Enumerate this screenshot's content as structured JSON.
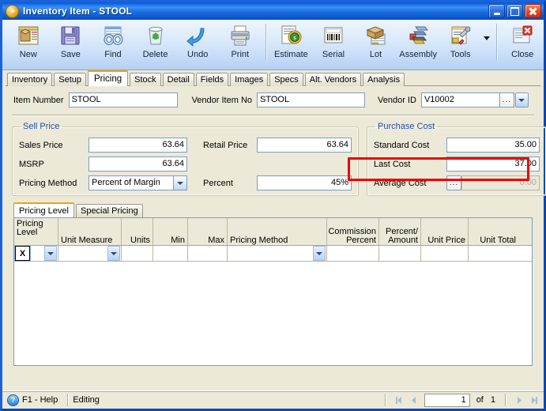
{
  "window": {
    "title_main": "Inventory Item",
    "title_sep": " - ",
    "title_item": "STOOL",
    "icon": "orange-play-icon",
    "controls": {
      "minimize": "Minimize",
      "maximize": "Maximize",
      "close": "Close"
    }
  },
  "toolbar": {
    "items": [
      {
        "label": "New",
        "icon": "new-item-icon"
      },
      {
        "label": "Save",
        "icon": "floppy-disk-icon"
      },
      {
        "label": "Find",
        "icon": "binoculars-icon"
      },
      {
        "label": "Delete",
        "icon": "recycle-bin-icon"
      },
      {
        "label": "Undo",
        "icon": "undo-arrow-icon"
      },
      {
        "label": "Print",
        "icon": "printer-icon"
      },
      {
        "label": "Estimate",
        "icon": "estimate-tag-icon"
      },
      {
        "label": "Serial",
        "icon": "barcode-icon"
      },
      {
        "label": "Lot",
        "icon": "lot-box-icon"
      },
      {
        "label": "Assembly",
        "icon": "assembly-icon"
      },
      {
        "label": "Tools",
        "icon": "tools-wrench-icon"
      },
      {
        "label": "Close",
        "icon": "close-window-icon"
      }
    ],
    "tools_dropdown": "chevron-down-icon"
  },
  "tabs": [
    {
      "label": "Inventory",
      "active": false
    },
    {
      "label": "Setup",
      "active": false
    },
    {
      "label": "Pricing",
      "active": true
    },
    {
      "label": "Stock",
      "active": false
    },
    {
      "label": "Detail",
      "active": false
    },
    {
      "label": "Fields",
      "active": false
    },
    {
      "label": "Images",
      "active": false
    },
    {
      "label": "Specs",
      "active": false
    },
    {
      "label": "Alt. Vendors",
      "active": false
    },
    {
      "label": "Analysis",
      "active": false
    }
  ],
  "header_fields": {
    "item_number_label": "Item Number",
    "item_number_value": "STOOL",
    "vendor_item_no_label": "Vendor Item No",
    "vendor_item_no_value": "STOOL",
    "vendor_id_label": "Vendor ID",
    "vendor_id_value": "V10002",
    "vendor_id_ellipsis": "...",
    "vendor_id_dropdown": "chevron-down-icon"
  },
  "sell_price": {
    "legend": "Sell Price",
    "sales_price_label": "Sales Price",
    "sales_price_value": "63.64",
    "retail_price_label": "Retail Price",
    "retail_price_value": "63.64",
    "msrp_label": "MSRP",
    "msrp_value": "63.64",
    "pricing_method_label": "Pricing Method",
    "pricing_method_value": "Percent of Margin",
    "percent_label": "Percent",
    "percent_value": "45%"
  },
  "purchase_cost": {
    "legend": "Purchase Cost",
    "standard_cost_label": "Standard Cost",
    "standard_cost_value": "35.00",
    "last_cost_label": "Last Cost",
    "last_cost_value": "37.00",
    "average_cost_label": "Average Cost",
    "average_cost_ellipsis": "...",
    "average_cost_value": "0.00",
    "highlight_color": "#ee0000",
    "highlight_target": "last-cost-row"
  },
  "sub_tabs": [
    {
      "label": "Pricing Level",
      "active": true
    },
    {
      "label": "Special Pricing",
      "active": false
    }
  ],
  "grid": {
    "columns": [
      {
        "line1": "Pricing",
        "line2": "Level",
        "align": "left",
        "width": 56
      },
      {
        "line1": "",
        "line2": "Unit Measure",
        "align": "left",
        "width": 80
      },
      {
        "line1": "",
        "line2": "Units",
        "align": "right",
        "width": 40
      },
      {
        "line1": "",
        "line2": "Min",
        "align": "right",
        "width": 44
      },
      {
        "line1": "",
        "line2": "Max",
        "align": "right",
        "width": 50
      },
      {
        "line1": "",
        "line2": "Pricing Method",
        "align": "left",
        "width": 126
      },
      {
        "line1": "Commission",
        "line2": "Percent",
        "align": "right",
        "width": 66
      },
      {
        "line1": "Percent/",
        "line2": "Amount",
        "align": "right",
        "width": 53
      },
      {
        "line1": "",
        "line2": "Unit Price",
        "align": "right",
        "width": 60
      },
      {
        "line1": "",
        "line2": "Unit Total",
        "align": "right",
        "width": 63
      }
    ],
    "edit_row": {
      "row_marker": "X",
      "pricing_level_dropdown": "chevron-down-icon",
      "unit_measure_dropdown": "chevron-down-icon",
      "pricing_method_dropdown": "chevron-down-icon"
    }
  },
  "status_bar": {
    "help_icon": "question-mark-icon",
    "help_label": "F1 - Help",
    "status_text": "Editing",
    "first_icon": "first-record-icon",
    "prev_icon": "previous-record-icon",
    "page_value": "1",
    "of_text": "of",
    "total_pages": "1",
    "next_icon": "next-record-icon",
    "last_icon": "last-record-icon"
  }
}
